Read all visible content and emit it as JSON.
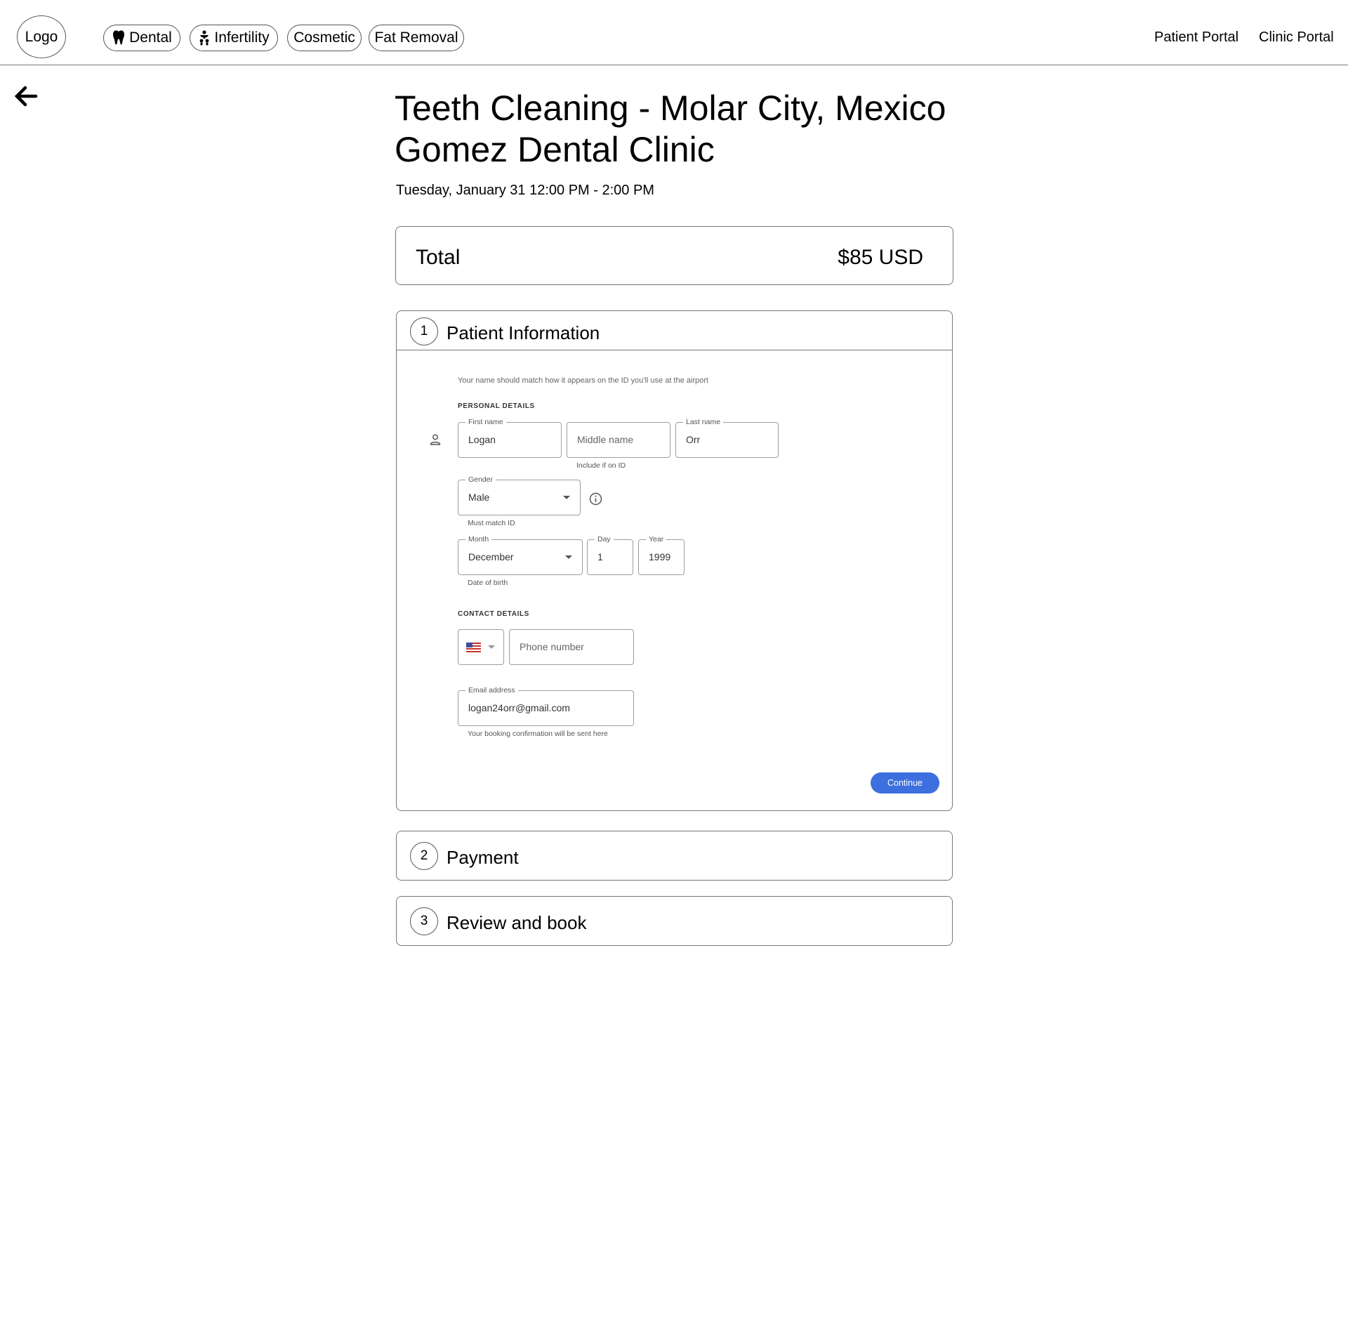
{
  "header": {
    "logo": "Logo",
    "categories": [
      {
        "label": "Dental",
        "icon": "tooth-icon"
      },
      {
        "label": "Infertility",
        "icon": "family-icon"
      },
      {
        "label": "Cosmetic",
        "icon": ""
      },
      {
        "label": "Fat Removal",
        "icon": ""
      }
    ],
    "links": [
      "Patient Portal",
      "Clinic Portal"
    ]
  },
  "back_icon": "arrow-left-icon",
  "booking": {
    "title_line1": "Teeth Cleaning - Molar City, Mexico",
    "title_line2": "Gomez Dental Clinic",
    "datetime": "Tuesday, January 31 12:00 PM - 2:00 PM",
    "total_label": "Total",
    "total_value": "$85 USD"
  },
  "steps": [
    {
      "number": "1",
      "title": "Patient Information"
    },
    {
      "number": "2",
      "title": "Payment"
    },
    {
      "number": "3",
      "title": "Review and book"
    }
  ],
  "form": {
    "note": "Your name should match how it appears on the ID you'll use at the airport",
    "personal_details_label": "PERSONAL DETAILS",
    "first_name": {
      "label": "First name",
      "value": "Logan"
    },
    "middle_name": {
      "placeholder": "Middle name",
      "helper": "Include if on ID"
    },
    "last_name": {
      "label": "Last name",
      "value": "Orr"
    },
    "gender": {
      "label": "Gender",
      "value": "Male",
      "helper": "Must match ID"
    },
    "month": {
      "label": "Month",
      "value": "December"
    },
    "day": {
      "label": "Day",
      "value": "1"
    },
    "year": {
      "label": "Year",
      "value": "1999"
    },
    "dob_helper": "Date of birth",
    "contact_details_label": "CONTACT DETAILS",
    "phone": {
      "placeholder": "Phone number",
      "country_icon": "us-flag-icon"
    },
    "email": {
      "label": "Email address",
      "value": "logan24orr@gmail.com",
      "helper": "Your booking confirmation will be sent here"
    },
    "continue_label": "Continue"
  },
  "colors": {
    "accent": "#3d6fde",
    "border": "#777777"
  }
}
